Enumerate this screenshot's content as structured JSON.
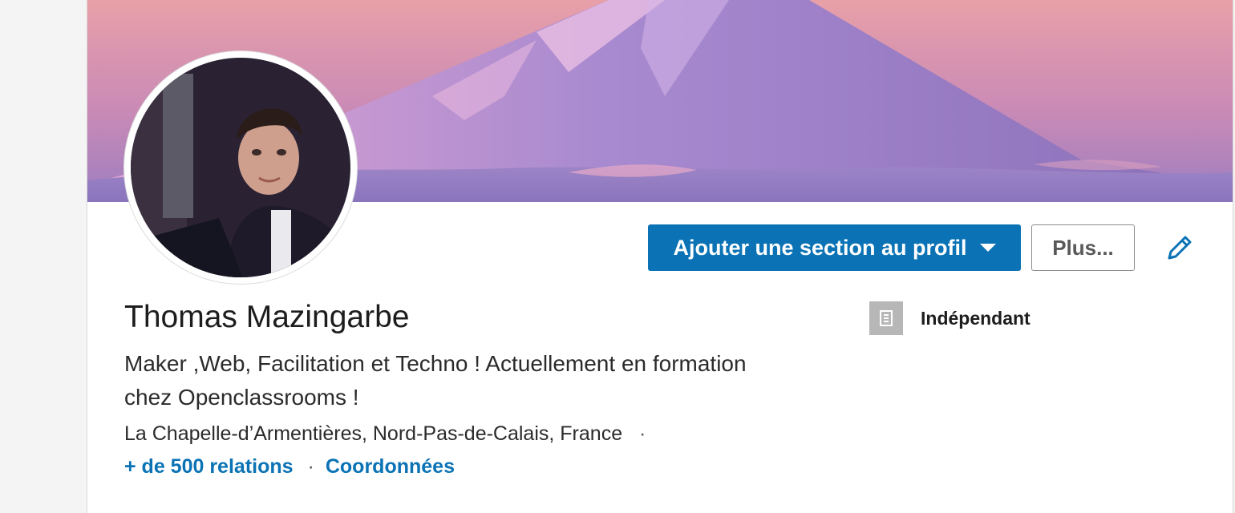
{
  "profile": {
    "name": "Thomas Mazingarbe",
    "headline": "Maker ,Web, Facilitation et Techno ! Actuellement en formation chez Openclassrooms !",
    "location": "La Chapelle-d’Armentières, Nord-Pas-de-Calais, France",
    "location_separator": "·",
    "connections_label": "+ de 500 relations",
    "links_separator": "·",
    "contact_info_label": "Coordonnées"
  },
  "actions": {
    "add_section_label": "Ajouter une section au profil",
    "more_label": "Plus...",
    "edit_icon": "pencil-icon",
    "dropdown_icon": "caret-down-icon"
  },
  "current_company": {
    "name": "Indépendant",
    "logo_icon": "building-icon"
  },
  "colors": {
    "primary": "#0b73b5",
    "link": "#0b73b5",
    "text": "#1d1d1d"
  }
}
